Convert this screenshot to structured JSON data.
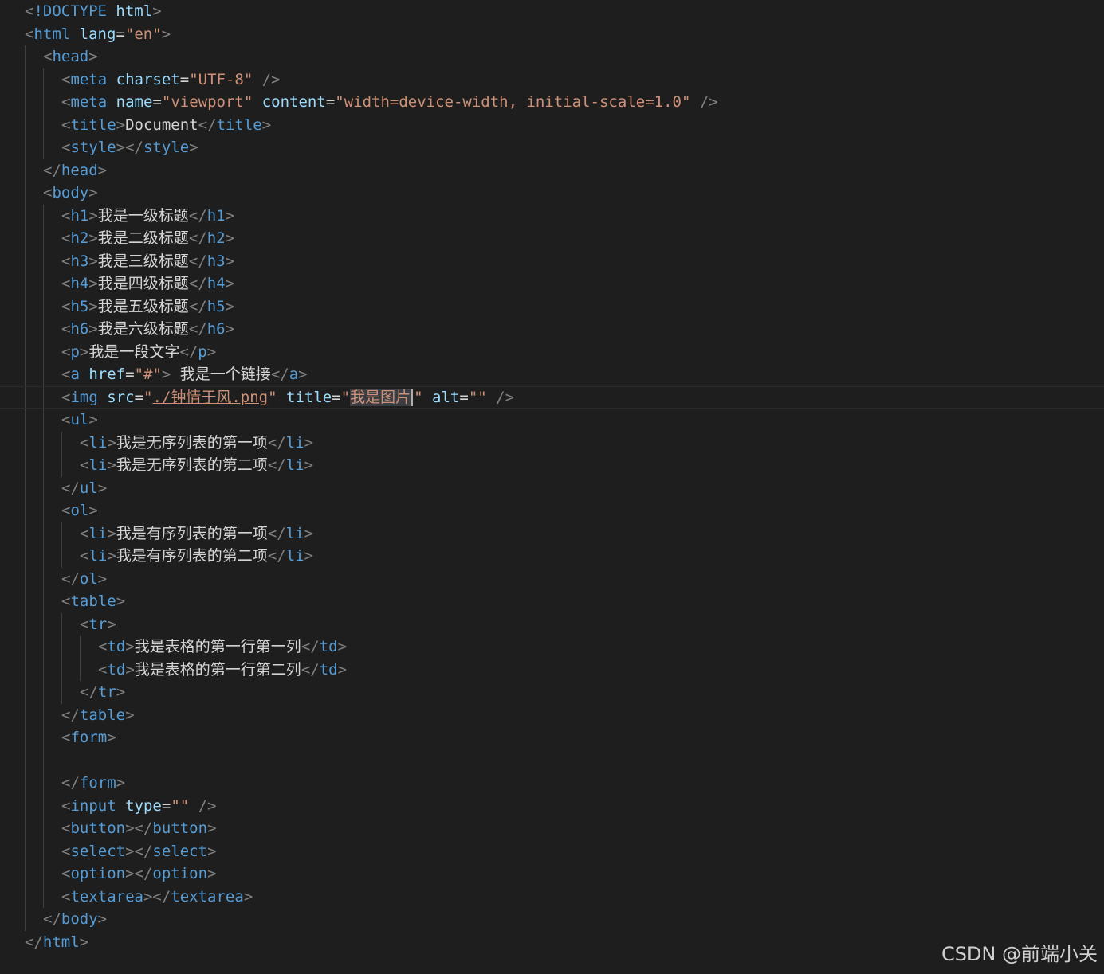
{
  "editor": {
    "theme_colors": {
      "background": "#1e1e1e",
      "punctuation": "#808080",
      "tag": "#569cd6",
      "attribute": "#9cdcfe",
      "string": "#ce9178",
      "text": "#d4d4d4"
    },
    "lines": [
      {
        "indent": 0,
        "tokens": [
          [
            "p",
            "<"
          ],
          [
            "d",
            "!DOCTYPE"
          ],
          [
            "x",
            " "
          ],
          [
            "a",
            "html"
          ],
          [
            "p",
            ">"
          ]
        ]
      },
      {
        "indent": 0,
        "tokens": [
          [
            "p",
            "<"
          ],
          [
            "t",
            "html"
          ],
          [
            "x",
            " "
          ],
          [
            "a",
            "lang"
          ],
          [
            "x",
            "="
          ],
          [
            "s",
            "\"en\""
          ],
          [
            "p",
            ">"
          ]
        ]
      },
      {
        "indent": 1,
        "tokens": [
          [
            "p",
            "<"
          ],
          [
            "t",
            "head"
          ],
          [
            "p",
            ">"
          ]
        ]
      },
      {
        "indent": 2,
        "tokens": [
          [
            "p",
            "<"
          ],
          [
            "t",
            "meta"
          ],
          [
            "x",
            " "
          ],
          [
            "a",
            "charset"
          ],
          [
            "x",
            "="
          ],
          [
            "s",
            "\"UTF-8\""
          ],
          [
            "x",
            " "
          ],
          [
            "p",
            "/>"
          ]
        ]
      },
      {
        "indent": 2,
        "tokens": [
          [
            "p",
            "<"
          ],
          [
            "t",
            "meta"
          ],
          [
            "x",
            " "
          ],
          [
            "a",
            "name"
          ],
          [
            "x",
            "="
          ],
          [
            "s",
            "\"viewport\""
          ],
          [
            "x",
            " "
          ],
          [
            "a",
            "content"
          ],
          [
            "x",
            "="
          ],
          [
            "s",
            "\"width=device-width, initial-scale=1.0\""
          ],
          [
            "x",
            " "
          ],
          [
            "p",
            "/>"
          ]
        ]
      },
      {
        "indent": 2,
        "tokens": [
          [
            "p",
            "<"
          ],
          [
            "t",
            "title"
          ],
          [
            "p",
            ">"
          ],
          [
            "x",
            "Document"
          ],
          [
            "p",
            "</"
          ],
          [
            "t",
            "title"
          ],
          [
            "p",
            ">"
          ]
        ]
      },
      {
        "indent": 2,
        "tokens": [
          [
            "p",
            "<"
          ],
          [
            "t",
            "style"
          ],
          [
            "p",
            "></"
          ],
          [
            "t",
            "style"
          ],
          [
            "p",
            ">"
          ]
        ]
      },
      {
        "indent": 1,
        "tokens": [
          [
            "p",
            "</"
          ],
          [
            "t",
            "head"
          ],
          [
            "p",
            ">"
          ]
        ]
      },
      {
        "indent": 1,
        "tokens": [
          [
            "p",
            "<"
          ],
          [
            "t",
            "body"
          ],
          [
            "p",
            ">"
          ]
        ]
      },
      {
        "indent": 2,
        "tokens": [
          [
            "p",
            "<"
          ],
          [
            "t",
            "h1"
          ],
          [
            "p",
            ">"
          ],
          [
            "x",
            "我是一级标题"
          ],
          [
            "p",
            "</"
          ],
          [
            "t",
            "h1"
          ],
          [
            "p",
            ">"
          ]
        ]
      },
      {
        "indent": 2,
        "tokens": [
          [
            "p",
            "<"
          ],
          [
            "t",
            "h2"
          ],
          [
            "p",
            ">"
          ],
          [
            "x",
            "我是二级标题"
          ],
          [
            "p",
            "</"
          ],
          [
            "t",
            "h2"
          ],
          [
            "p",
            ">"
          ]
        ]
      },
      {
        "indent": 2,
        "tokens": [
          [
            "p",
            "<"
          ],
          [
            "t",
            "h3"
          ],
          [
            "p",
            ">"
          ],
          [
            "x",
            "我是三级标题"
          ],
          [
            "p",
            "</"
          ],
          [
            "t",
            "h3"
          ],
          [
            "p",
            ">"
          ]
        ]
      },
      {
        "indent": 2,
        "tokens": [
          [
            "p",
            "<"
          ],
          [
            "t",
            "h4"
          ],
          [
            "p",
            ">"
          ],
          [
            "x",
            "我是四级标题"
          ],
          [
            "p",
            "</"
          ],
          [
            "t",
            "h4"
          ],
          [
            "p",
            ">"
          ]
        ]
      },
      {
        "indent": 2,
        "tokens": [
          [
            "p",
            "<"
          ],
          [
            "t",
            "h5"
          ],
          [
            "p",
            ">"
          ],
          [
            "x",
            "我是五级标题"
          ],
          [
            "p",
            "</"
          ],
          [
            "t",
            "h5"
          ],
          [
            "p",
            ">"
          ]
        ]
      },
      {
        "indent": 2,
        "tokens": [
          [
            "p",
            "<"
          ],
          [
            "t",
            "h6"
          ],
          [
            "p",
            ">"
          ],
          [
            "x",
            "我是六级标题"
          ],
          [
            "p",
            "</"
          ],
          [
            "t",
            "h6"
          ],
          [
            "p",
            ">"
          ]
        ]
      },
      {
        "indent": 2,
        "tokens": [
          [
            "p",
            "<"
          ],
          [
            "t",
            "p"
          ],
          [
            "p",
            ">"
          ],
          [
            "x",
            "我是一段文字"
          ],
          [
            "p",
            "</"
          ],
          [
            "t",
            "p"
          ],
          [
            "p",
            ">"
          ]
        ]
      },
      {
        "indent": 2,
        "tokens": [
          [
            "p",
            "<"
          ],
          [
            "t",
            "a"
          ],
          [
            "x",
            " "
          ],
          [
            "a",
            "href"
          ],
          [
            "x",
            "="
          ],
          [
            "s",
            "\"#\""
          ],
          [
            "p",
            ">"
          ],
          [
            "x",
            " 我是一个链接"
          ],
          [
            "p",
            "</"
          ],
          [
            "t",
            "a"
          ],
          [
            "p",
            ">"
          ]
        ]
      },
      {
        "indent": 2,
        "current": true,
        "tokens": [
          [
            "p",
            "<"
          ],
          [
            "t",
            "img"
          ],
          [
            "x",
            " "
          ],
          [
            "a",
            "src"
          ],
          [
            "x",
            "="
          ],
          [
            "s",
            "\""
          ],
          [
            "su",
            "./钟情于风.png"
          ],
          [
            "s",
            "\""
          ],
          [
            "x",
            " "
          ],
          [
            "a",
            "title"
          ],
          [
            "x",
            "="
          ],
          [
            "s",
            "\""
          ],
          [
            "ss",
            "我是图片"
          ],
          [
            "cur",
            ""
          ],
          [
            "s",
            "\""
          ],
          [
            "x",
            " "
          ],
          [
            "a",
            "alt"
          ],
          [
            "x",
            "="
          ],
          [
            "s",
            "\"\""
          ],
          [
            "x",
            " "
          ],
          [
            "p",
            "/>"
          ]
        ]
      },
      {
        "indent": 2,
        "tokens": [
          [
            "p",
            "<"
          ],
          [
            "t",
            "ul"
          ],
          [
            "p",
            ">"
          ]
        ]
      },
      {
        "indent": 3,
        "tokens": [
          [
            "p",
            "<"
          ],
          [
            "t",
            "li"
          ],
          [
            "p",
            ">"
          ],
          [
            "x",
            "我是无序列表的第一项"
          ],
          [
            "p",
            "</"
          ],
          [
            "t",
            "li"
          ],
          [
            "p",
            ">"
          ]
        ]
      },
      {
        "indent": 3,
        "tokens": [
          [
            "p",
            "<"
          ],
          [
            "t",
            "li"
          ],
          [
            "p",
            ">"
          ],
          [
            "x",
            "我是无序列表的第二项"
          ],
          [
            "p",
            "</"
          ],
          [
            "t",
            "li"
          ],
          [
            "p",
            ">"
          ]
        ]
      },
      {
        "indent": 2,
        "tokens": [
          [
            "p",
            "</"
          ],
          [
            "t",
            "ul"
          ],
          [
            "p",
            ">"
          ]
        ]
      },
      {
        "indent": 2,
        "tokens": [
          [
            "p",
            "<"
          ],
          [
            "t",
            "ol"
          ],
          [
            "p",
            ">"
          ]
        ]
      },
      {
        "indent": 3,
        "tokens": [
          [
            "p",
            "<"
          ],
          [
            "t",
            "li"
          ],
          [
            "p",
            ">"
          ],
          [
            "x",
            "我是有序列表的第一项"
          ],
          [
            "p",
            "</"
          ],
          [
            "t",
            "li"
          ],
          [
            "p",
            ">"
          ]
        ]
      },
      {
        "indent": 3,
        "tokens": [
          [
            "p",
            "<"
          ],
          [
            "t",
            "li"
          ],
          [
            "p",
            ">"
          ],
          [
            "x",
            "我是有序列表的第二项"
          ],
          [
            "p",
            "</"
          ],
          [
            "t",
            "li"
          ],
          [
            "p",
            ">"
          ]
        ]
      },
      {
        "indent": 2,
        "tokens": [
          [
            "p",
            "</"
          ],
          [
            "t",
            "ol"
          ],
          [
            "p",
            ">"
          ]
        ]
      },
      {
        "indent": 2,
        "tokens": [
          [
            "p",
            "<"
          ],
          [
            "t",
            "table"
          ],
          [
            "p",
            ">"
          ]
        ]
      },
      {
        "indent": 3,
        "tokens": [
          [
            "p",
            "<"
          ],
          [
            "t",
            "tr"
          ],
          [
            "p",
            ">"
          ]
        ]
      },
      {
        "indent": 4,
        "tokens": [
          [
            "p",
            "<"
          ],
          [
            "t",
            "td"
          ],
          [
            "p",
            ">"
          ],
          [
            "x",
            "我是表格的第一行第一列"
          ],
          [
            "p",
            "</"
          ],
          [
            "t",
            "td"
          ],
          [
            "p",
            ">"
          ]
        ]
      },
      {
        "indent": 4,
        "tokens": [
          [
            "p",
            "<"
          ],
          [
            "t",
            "td"
          ],
          [
            "p",
            ">"
          ],
          [
            "x",
            "我是表格的第一行第二列"
          ],
          [
            "p",
            "</"
          ],
          [
            "t",
            "td"
          ],
          [
            "p",
            ">"
          ]
        ]
      },
      {
        "indent": 3,
        "tokens": [
          [
            "p",
            "</"
          ],
          [
            "t",
            "tr"
          ],
          [
            "p",
            ">"
          ]
        ]
      },
      {
        "indent": 2,
        "tokens": [
          [
            "p",
            "</"
          ],
          [
            "t",
            "table"
          ],
          [
            "p",
            ">"
          ]
        ]
      },
      {
        "indent": 2,
        "tokens": [
          [
            "p",
            "<"
          ],
          [
            "t",
            "form"
          ],
          [
            "p",
            ">"
          ]
        ]
      },
      {
        "indent": 2,
        "tokens": []
      },
      {
        "indent": 2,
        "tokens": [
          [
            "p",
            "</"
          ],
          [
            "t",
            "form"
          ],
          [
            "p",
            ">"
          ]
        ]
      },
      {
        "indent": 2,
        "tokens": [
          [
            "p",
            "<"
          ],
          [
            "t",
            "input"
          ],
          [
            "x",
            " "
          ],
          [
            "a",
            "type"
          ],
          [
            "x",
            "="
          ],
          [
            "s",
            "\"\""
          ],
          [
            "x",
            " "
          ],
          [
            "p",
            "/>"
          ]
        ]
      },
      {
        "indent": 2,
        "tokens": [
          [
            "p",
            "<"
          ],
          [
            "t",
            "button"
          ],
          [
            "p",
            "></"
          ],
          [
            "t",
            "button"
          ],
          [
            "p",
            ">"
          ]
        ]
      },
      {
        "indent": 2,
        "tokens": [
          [
            "p",
            "<"
          ],
          [
            "t",
            "select"
          ],
          [
            "p",
            "></"
          ],
          [
            "t",
            "select"
          ],
          [
            "p",
            ">"
          ]
        ]
      },
      {
        "indent": 2,
        "tokens": [
          [
            "p",
            "<"
          ],
          [
            "t",
            "option"
          ],
          [
            "p",
            "></"
          ],
          [
            "t",
            "option"
          ],
          [
            "p",
            ">"
          ]
        ]
      },
      {
        "indent": 2,
        "tokens": [
          [
            "p",
            "<"
          ],
          [
            "t",
            "textarea"
          ],
          [
            "p",
            "></"
          ],
          [
            "t",
            "textarea"
          ],
          [
            "p",
            ">"
          ]
        ]
      },
      {
        "indent": 1,
        "tokens": [
          [
            "p",
            "</"
          ],
          [
            "t",
            "body"
          ],
          [
            "p",
            ">"
          ]
        ]
      },
      {
        "indent": 0,
        "tokens": [
          [
            "p",
            "</"
          ],
          [
            "t",
            "html"
          ],
          [
            "p",
            ">"
          ]
        ]
      }
    ]
  },
  "watermark": {
    "text": "CSDN @前端小关"
  }
}
